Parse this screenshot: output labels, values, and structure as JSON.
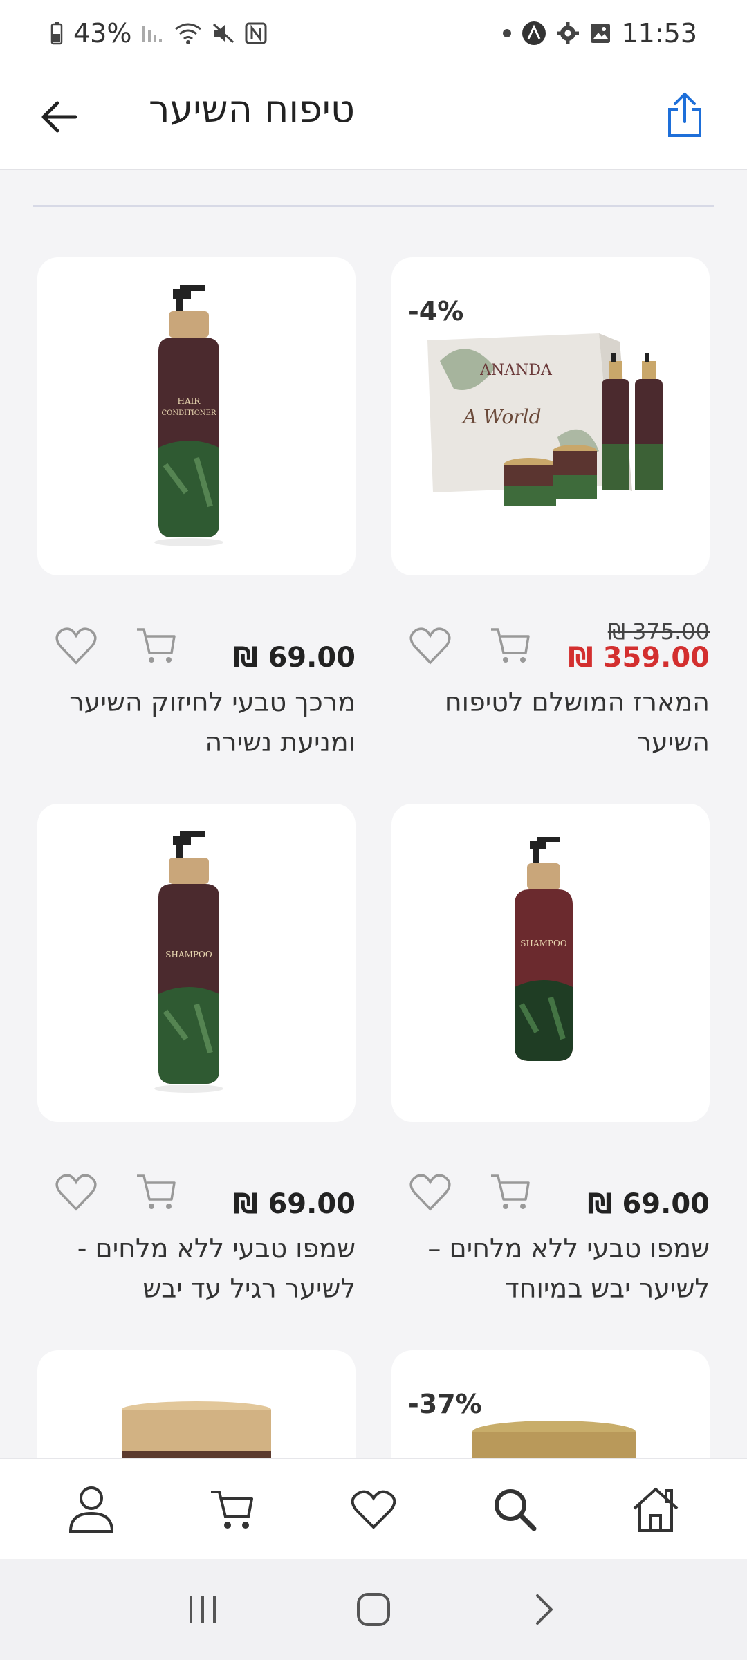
{
  "status_bar": {
    "battery": "43%",
    "time": "11:53",
    "icons": [
      "battery-icon",
      "signal-icon",
      "wifi-icon",
      "mute-icon",
      "nfc-icon",
      "dot-icon",
      "app-icon",
      "gear-icon",
      "image-icon"
    ]
  },
  "header": {
    "title": "טיפוח השיער",
    "back_icon": "arrow-left-icon",
    "share_icon": "share-icon"
  },
  "products": [
    {
      "name": "המארז המושלם לטיפוח השיער",
      "old_price": "375.00 ₪",
      "price": "359.00 ₪",
      "discount": "-4%",
      "image": "gift-set-box"
    },
    {
      "name": "מרכך טבעי לחיזוק השיער ומניעת נשירה",
      "price": "69.00 ₪",
      "image": "conditioner-bottle"
    },
    {
      "name": "שמפו טבעי ללא מלחים – לשיער יבש במיוחד",
      "price": "69.00 ₪",
      "image": "shampoo-bottle-red"
    },
    {
      "name": "שמפו טבעי ללא מלחים - לשיער רגיל עד יבש",
      "price": "69.00 ₪",
      "image": "shampoo-bottle"
    },
    {
      "discount": "-37%",
      "image": "jar-gold-lid"
    },
    {
      "image": "jar-wood-lid"
    }
  ],
  "bottom_nav": [
    "home-icon",
    "search-icon",
    "heart-icon",
    "cart-icon",
    "profile-icon"
  ],
  "system_nav": [
    "back-chevron-icon",
    "home-circle-icon",
    "recents-icon"
  ],
  "colors": {
    "accent": "#1e6fd9",
    "sale": "#d32f2f",
    "background": "#f4f4f6"
  }
}
